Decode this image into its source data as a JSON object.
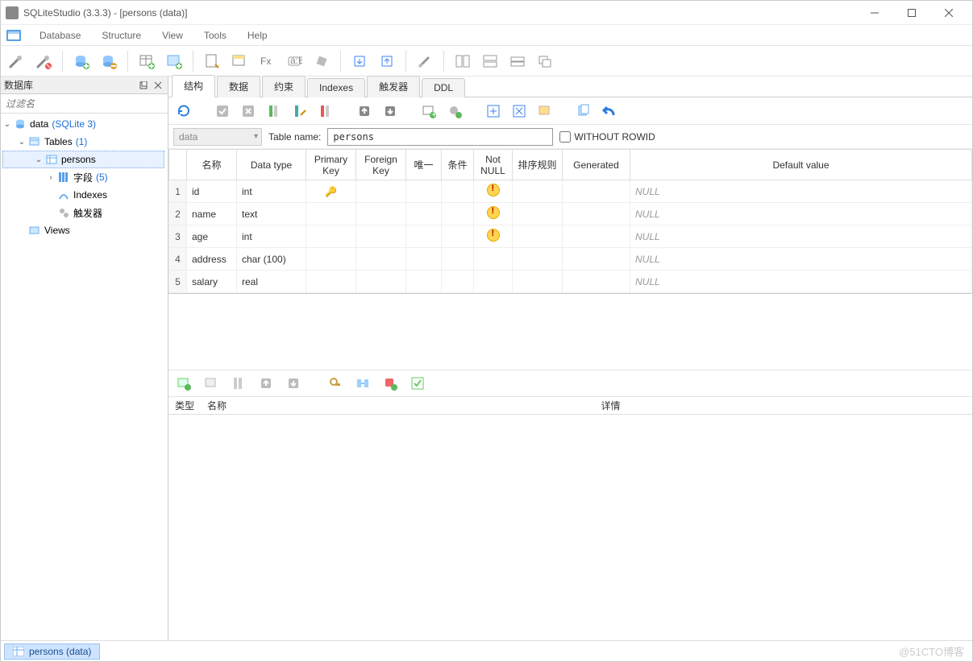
{
  "title": "SQLiteStudio (3.3.3) - [persons (data)]",
  "menus": [
    "Database",
    "Structure",
    "View",
    "Tools",
    "Help"
  ],
  "left_panel": {
    "title": "数据库",
    "filter_placeholder": "过滤名"
  },
  "tree": {
    "db_name": "data",
    "db_type": "(SQLite 3)",
    "tables_label": "Tables",
    "tables_count": "(1)",
    "table_name": "persons",
    "columns_label": "字段",
    "columns_count": "(5)",
    "indexes_label": "Indexes",
    "triggers_label": "触发器",
    "views_label": "Views"
  },
  "tabs": [
    "结构",
    "数据",
    "约束",
    "Indexes",
    "触发器",
    "DDL"
  ],
  "active_tab_index": 0,
  "table_form": {
    "db_selector": "data",
    "name_label": "Table name:",
    "name_value": "persons",
    "without_rowid_label": "WITHOUT ROWID",
    "without_rowid_checked": false
  },
  "grid": {
    "headers": [
      "名称",
      "Data type",
      "Primary Key",
      "Foreign Key",
      "唯一",
      "条件",
      "Not NULL",
      "排序规则",
      "Generated",
      "Default value"
    ],
    "rows": [
      {
        "n": 1,
        "name": "id",
        "type": "int",
        "pk": true,
        "fk": false,
        "unique": false,
        "check": false,
        "notnull": true,
        "collate": "",
        "generated": "",
        "default": "NULL"
      },
      {
        "n": 2,
        "name": "name",
        "type": "text",
        "pk": false,
        "fk": false,
        "unique": false,
        "check": false,
        "notnull": true,
        "collate": "",
        "generated": "",
        "default": "NULL"
      },
      {
        "n": 3,
        "name": "age",
        "type": "int",
        "pk": false,
        "fk": false,
        "unique": false,
        "check": false,
        "notnull": true,
        "collate": "",
        "generated": "",
        "default": "NULL"
      },
      {
        "n": 4,
        "name": "address",
        "type": "char (100)",
        "pk": false,
        "fk": false,
        "unique": false,
        "check": false,
        "notnull": false,
        "collate": "",
        "generated": "",
        "default": "NULL"
      },
      {
        "n": 5,
        "name": "salary",
        "type": "real",
        "pk": false,
        "fk": false,
        "unique": false,
        "check": false,
        "notnull": false,
        "collate": "",
        "generated": "",
        "default": "NULL"
      }
    ]
  },
  "details_headers": [
    "类型",
    "名称",
    "详情"
  ],
  "status_tab": "persons (data)",
  "watermark": "@51CTO博客"
}
